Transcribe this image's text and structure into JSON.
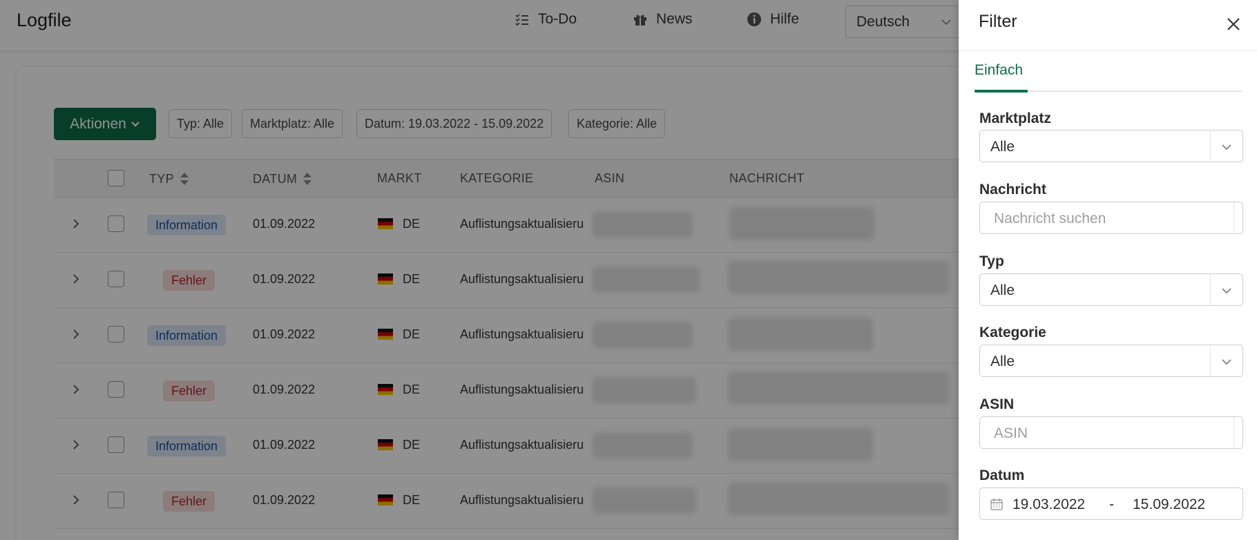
{
  "header": {
    "app_title": "Logfile",
    "nav": [
      {
        "label": "To-Do",
        "icon": "checklist-icon"
      },
      {
        "label": "News",
        "icon": "gift-icon"
      },
      {
        "label": "Hilfe",
        "icon": "info-icon"
      }
    ],
    "language": "Deutsch"
  },
  "toolbar": {
    "actions_label": "Aktionen",
    "chips": [
      "Typ: Alle",
      "Marktplatz: Alle",
      "Datum: 19.03.2022 - 15.09.2022",
      "Kategorie: Alle"
    ]
  },
  "table": {
    "columns": [
      "TYP",
      "DATUM",
      "MARKT",
      "KATEGORIE",
      "ASIN",
      "NACHRICHT"
    ],
    "rows": [
      {
        "type": "Information",
        "kind": "info",
        "date": "01.09.2022",
        "market": "DE",
        "category": "Auflistungsaktualisierung"
      },
      {
        "type": "Fehler",
        "kind": "error",
        "date": "01.09.2022",
        "market": "DE",
        "category": "Auflistungsaktualisierung"
      },
      {
        "type": "Information",
        "kind": "info",
        "date": "01.09.2022",
        "market": "DE",
        "category": "Auflistungsaktualisierung"
      },
      {
        "type": "Fehler",
        "kind": "error",
        "date": "01.09.2022",
        "market": "DE",
        "category": "Auflistungsaktualisierung"
      },
      {
        "type": "Information",
        "kind": "info",
        "date": "01.09.2022",
        "market": "DE",
        "category": "Auflistungsaktualisierung"
      },
      {
        "type": "Fehler",
        "kind": "error",
        "date": "01.09.2022",
        "market": "DE",
        "category": "Auflistungsaktualisierung"
      }
    ]
  },
  "filter_panel": {
    "title": "Filter",
    "tab_label": "Einfach",
    "marketplace": {
      "label": "Marktplatz",
      "value": "Alle"
    },
    "message": {
      "label": "Nachricht",
      "placeholder": "Nachricht suchen"
    },
    "type": {
      "label": "Typ",
      "value": "Alle"
    },
    "category": {
      "label": "Kategorie",
      "value": "Alle"
    },
    "asin": {
      "label": "ASIN",
      "placeholder": "ASIN"
    },
    "date": {
      "label": "Datum",
      "start": "19.03.2022",
      "dash": "-",
      "end": "15.09.2022"
    }
  },
  "colors": {
    "accent": "#0b6e4a",
    "info_badge_bg": "#dbe7f6",
    "info_badge_text": "#1d4b9a",
    "error_badge_bg": "#f6dada",
    "error_badge_text": "#b2262a"
  }
}
